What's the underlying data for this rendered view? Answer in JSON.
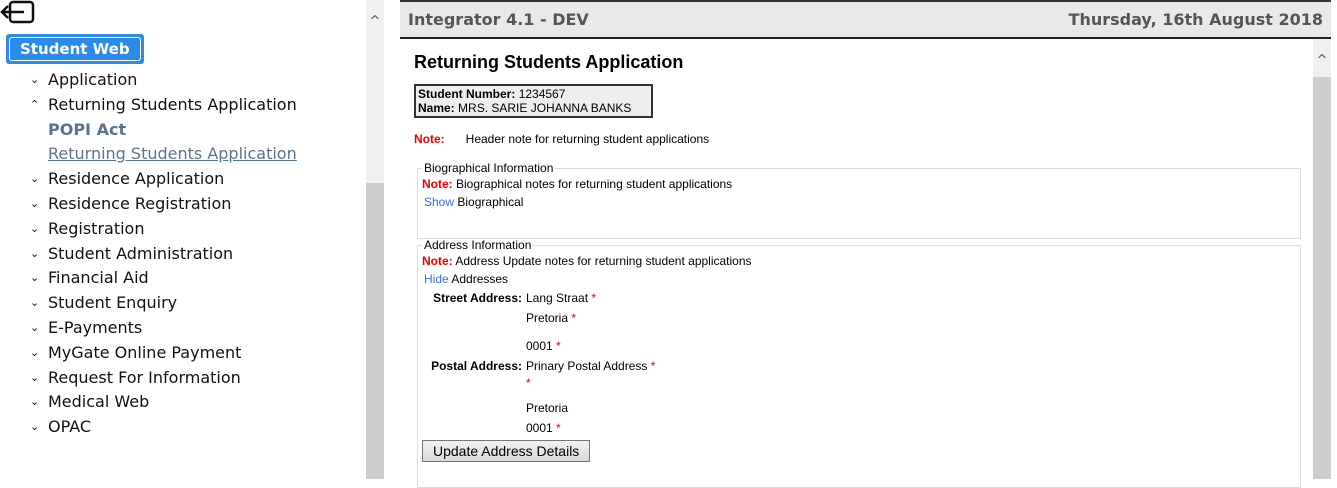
{
  "sidebar": {
    "root_button": "Student Web",
    "items": [
      {
        "label": "Application",
        "expanded": false
      },
      {
        "label": "Returning Students Application",
        "expanded": true
      },
      {
        "label": "Residence Application",
        "expanded": false
      },
      {
        "label": "Residence Registration",
        "expanded": false
      },
      {
        "label": "Registration",
        "expanded": false
      },
      {
        "label": "Student Administration",
        "expanded": false
      },
      {
        "label": "Financial Aid",
        "expanded": false
      },
      {
        "label": "Student Enquiry",
        "expanded": false
      },
      {
        "label": "E-Payments",
        "expanded": false
      },
      {
        "label": "MyGate Online Payment",
        "expanded": false
      },
      {
        "label": "Request For Information",
        "expanded": false
      },
      {
        "label": "Medical Web",
        "expanded": false
      },
      {
        "label": "OPAC",
        "expanded": false
      }
    ],
    "subitems": [
      "POPI Act",
      "Returning Students Application"
    ]
  },
  "header": {
    "title": "Integrator 4.1 - DEV",
    "date": "Thursday, 16th August 2018"
  },
  "main": {
    "title": "Returning Students Application",
    "student_number_label": "Student Number:",
    "student_number": "1234567",
    "name_label": "Name:",
    "name": "MRS. SARIE JOHANNA BANKS",
    "note_label": "Note:",
    "header_note": "Header note for returning student applications",
    "bio": {
      "legend": "Biographical Information",
      "note": "Biographical notes for returning student applications",
      "toggle": "Show",
      "toggle_target": "Biographical"
    },
    "address": {
      "legend": "Address Information",
      "note": "Address Update notes for returning student applications",
      "toggle": "Hide",
      "toggle_target": "Addresses",
      "street_label": "Street Address:",
      "street": [
        "Lang Straat",
        "Pretoria",
        "0001"
      ],
      "postal_label": "Postal Address:",
      "postal": [
        "Prinary Postal Address",
        "",
        "Pretoria",
        "0001"
      ],
      "required": "*",
      "update_button": "Update Address Details"
    }
  }
}
